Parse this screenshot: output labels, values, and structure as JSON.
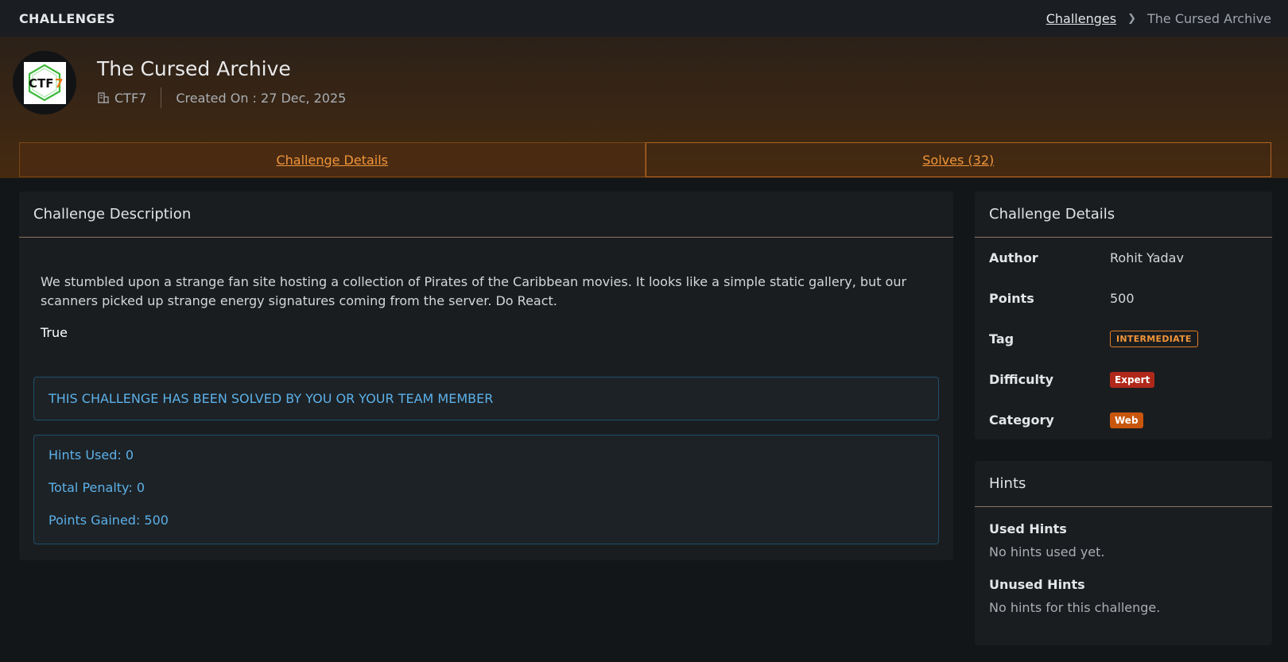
{
  "topbar": {
    "page_label": "CHALLENGES",
    "breadcrumb": {
      "link": "Challenges",
      "current": "The Cursed Archive"
    }
  },
  "hero": {
    "logo_text": "CTF7",
    "title": "The Cursed Archive",
    "org": "CTF7",
    "created": "Created On : 27 Dec, 2025"
  },
  "tabs": [
    {
      "label": "Challenge Details",
      "active": true
    },
    {
      "label": "Solves (32)",
      "active": false
    }
  ],
  "description": {
    "header": "Challenge Description",
    "text": "We stumbled upon a strange fan site hosting a collection of Pirates of the Caribbean movies. It looks like a simple static gallery, but our scanners picked up strange energy signatures coming from the server. Do React.",
    "extra": "True",
    "solved_alert": "THIS CHALLENGE HAS BEEN SOLVED BY YOU OR YOUR TEAM MEMBER",
    "stats": {
      "hints_used": "Hints Used: 0",
      "total_penalty": "Total Penalty: 0",
      "points_gained": "Points Gained: 500"
    }
  },
  "details": {
    "header": "Challenge Details",
    "author_label": "Author",
    "author": "Rohit Yadav",
    "points_label": "Points",
    "points": "500",
    "tag_label": "Tag",
    "tag": "INTERMEDIATE",
    "difficulty_label": "Difficulty",
    "difficulty": "Expert",
    "category_label": "Category",
    "category": "Web"
  },
  "hints": {
    "header": "Hints",
    "used_title": "Used Hints",
    "used_text": "No hints used yet.",
    "unused_title": "Unused Hints",
    "unused_text": "No hints for this challenge."
  },
  "colors": {
    "accent": "#f0953a",
    "info": "#5cb1e8",
    "expert": "#b0281a",
    "web": "#c8560d"
  }
}
